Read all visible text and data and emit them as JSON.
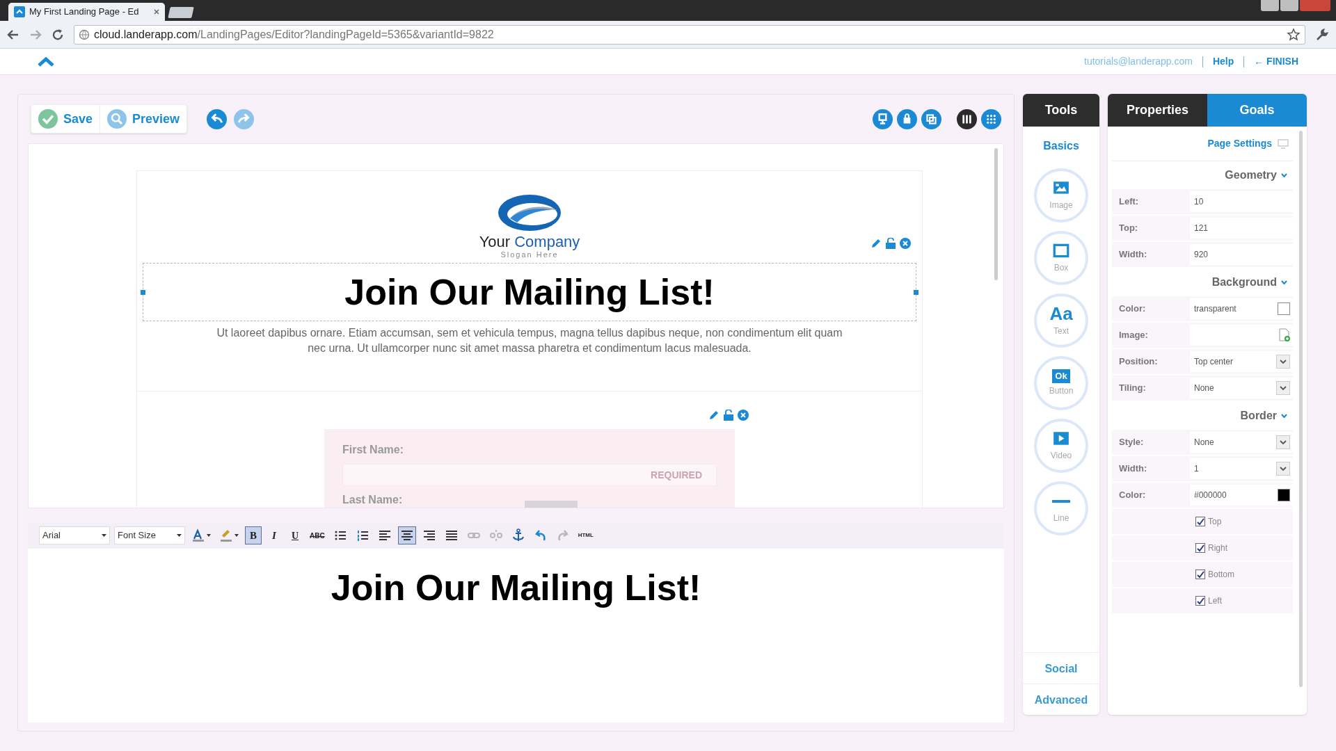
{
  "browser": {
    "tab_title": "My First Landing Page - Ed",
    "url_host": "cloud.landerapp.com",
    "url_path": "/LandingPages/Editor?landingPageId=5365&variantId=9822"
  },
  "header": {
    "email": "tutorials@landerapp.com",
    "help": "Help",
    "finish": "← FINISH"
  },
  "toolbar": {
    "save": "Save",
    "preview": "Preview",
    "view_modes": [
      {
        "selected": true
      },
      {
        "selected": false
      }
    ]
  },
  "canvas": {
    "company_first": "Your",
    "company_second": "Company",
    "slogan": "Slogan Here",
    "heading": "Join Our Mailing List!",
    "paragraph": "Ut laoreet dapibus ornare. Etiam accumsan, sem et vehicula tempus, magna tellus dapibus neque, non condimentum elit quam nec urna. Ut ullamcorper nunc sit amet massa pharetra et condimentum lacus malesuada.",
    "form": {
      "first_name": "First Name:",
      "required": "REQUIRED",
      "last_name": "Last Name:"
    }
  },
  "editor_toolbar": {
    "font": "Arial",
    "font_size": "Font Size",
    "tools": [
      {
        "kind": "text-color",
        "active": false,
        "disabled": false
      },
      {
        "kind": "highlight",
        "active": false,
        "disabled": false
      },
      {
        "kind": "glyph",
        "glyph": "B",
        "active": true,
        "disabled": false
      },
      {
        "kind": "glyph",
        "glyph": "I",
        "active": false,
        "disabled": false
      },
      {
        "kind": "glyph",
        "glyph": "U",
        "active": false,
        "disabled": false
      },
      {
        "kind": "glyph",
        "glyph": "ABC",
        "active": false,
        "disabled": false
      },
      {
        "kind": "bullets",
        "active": false,
        "disabled": false
      },
      {
        "kind": "numbers",
        "active": false,
        "disabled": false
      },
      {
        "kind": "align-left",
        "active": false,
        "disabled": false
      },
      {
        "kind": "align-center",
        "active": true,
        "disabled": false
      },
      {
        "kind": "align-right",
        "active": false,
        "disabled": false
      },
      {
        "kind": "justify",
        "active": false,
        "disabled": false
      },
      {
        "kind": "link",
        "active": false,
        "disabled": true
      },
      {
        "kind": "unlink",
        "active": false,
        "disabled": true
      },
      {
        "kind": "anchor",
        "active": false,
        "disabled": false
      },
      {
        "kind": "undo",
        "active": false,
        "disabled": false
      },
      {
        "kind": "redo",
        "active": false,
        "disabled": true
      },
      {
        "kind": "glyph",
        "glyph": "HTML",
        "active": false,
        "disabled": false
      }
    ]
  },
  "editor_text": "Join Our Mailing List!",
  "tools_panel": {
    "tab": "Tools",
    "section": "Basics",
    "items": [
      {
        "kind": "image",
        "label": "Image"
      },
      {
        "kind": "box",
        "label": "Box"
      },
      {
        "kind": "text",
        "label": "Text",
        "glyph": "Aa"
      },
      {
        "kind": "button",
        "label": "Button",
        "glyph": "Ok"
      },
      {
        "kind": "video",
        "label": "Video"
      },
      {
        "kind": "line",
        "label": "Line"
      }
    ],
    "bottom": [
      "Social",
      "Advanced"
    ]
  },
  "properties": {
    "tabs": [
      {
        "label": "Properties",
        "selected": false
      },
      {
        "label": "Goals",
        "selected": true
      }
    ],
    "page_settings": "Page Settings",
    "groups": [
      {
        "title": "Geometry",
        "rows": [
          {
            "kind": "text",
            "label": "Left:",
            "value": "10"
          },
          {
            "kind": "text",
            "label": "Top:",
            "value": "121"
          },
          {
            "kind": "text",
            "label": "Width:",
            "value": "920"
          }
        ]
      },
      {
        "title": "Background",
        "rows": [
          {
            "kind": "color",
            "label": "Color:",
            "value": "transparent"
          },
          {
            "kind": "file",
            "label": "Image:"
          },
          {
            "kind": "select",
            "label": "Position:",
            "value": "Top center"
          },
          {
            "kind": "select",
            "label": "Tiling:",
            "value": "None"
          }
        ]
      },
      {
        "title": "Border",
        "rows": [
          {
            "kind": "select",
            "label": "Style:",
            "value": "None"
          },
          {
            "kind": "select",
            "label": "Width:",
            "value": "1"
          },
          {
            "kind": "color",
            "label": "Color:",
            "value": "#000000",
            "color": "#000000"
          },
          {
            "kind": "check",
            "label": "Top",
            "checked": true
          },
          {
            "kind": "check",
            "label": "Right",
            "checked": true
          },
          {
            "kind": "check",
            "label": "Bottom",
            "checked": true
          },
          {
            "kind": "check",
            "label": "Left",
            "checked": true
          }
        ]
      }
    ]
  }
}
